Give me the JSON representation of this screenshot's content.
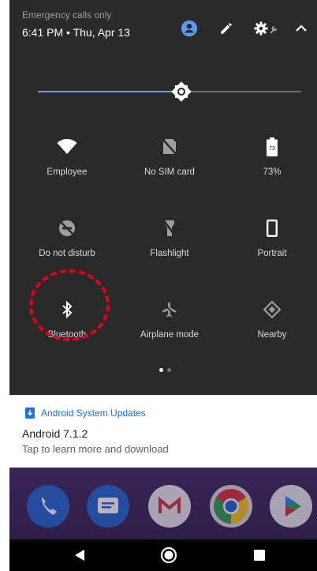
{
  "status": {
    "emergency": "Emergency calls only",
    "time_date": "6:41 PM • Thu, Apr 13"
  },
  "header_icons": [
    "account-icon",
    "edit-icon",
    "settings-icon",
    "collapse-icon"
  ],
  "tiles": {
    "wifi": {
      "label": "Employee"
    },
    "sim": {
      "label": "No SIM card"
    },
    "battery": {
      "label": "73%",
      "badge": "73"
    },
    "dnd": {
      "label": "Do not disturb"
    },
    "flashlight": {
      "label": "Flashlight"
    },
    "rotation": {
      "label": "Portrait"
    },
    "bluetooth": {
      "label": "Bluetooth"
    },
    "airplane": {
      "label": "Airplane mode"
    },
    "nearby": {
      "label": "Nearby"
    }
  },
  "notification": {
    "app": "Android System Updates",
    "title": "Android 7.1.2",
    "text": "Tap to learn more and download"
  },
  "dock": [
    "phone-icon",
    "messages-icon",
    "gmail-icon",
    "chrome-icon",
    "play-store-icon"
  ],
  "nav": [
    "back-icon",
    "home-icon",
    "recents-icon"
  ],
  "brightness_level": 0.57,
  "colors": {
    "accent": "#6d9eeb",
    "highlight": "#e0001b",
    "link": "#1a73e8"
  }
}
